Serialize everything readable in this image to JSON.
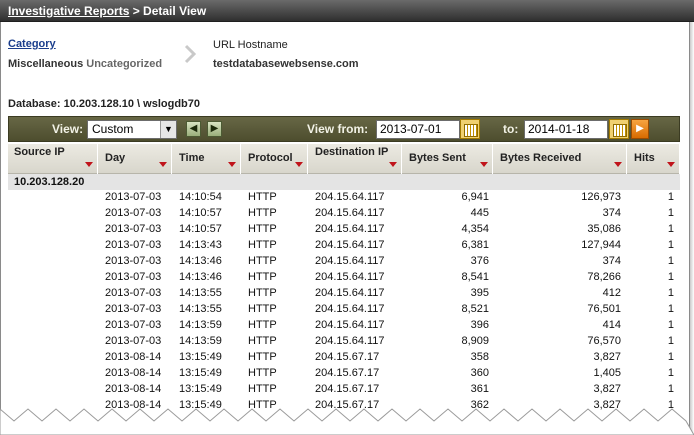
{
  "header": {
    "breadcrumb_link": "Investigative Reports",
    "breadcrumb_tail": " > Detail View"
  },
  "criteria": {
    "category_label": "Category",
    "category_value_main": "Miscellaneous",
    "category_value_sub": "Uncategorized",
    "url_header": "URL Hostname",
    "url_value": "testdatabasewebsense.com"
  },
  "database": {
    "label": "Database:",
    "value": "10.203.128.10 \\ wslogdb70"
  },
  "toolbar": {
    "view_label": "View:",
    "view_selected": "Custom",
    "view_from_label": "View from:",
    "from_date": "2013-07-01",
    "to_label": "to:",
    "to_date": "2014-01-18"
  },
  "table": {
    "columns": [
      "Source IP",
      "Day",
      "Time",
      "Protocol",
      "Destination IP",
      "Bytes Sent",
      "Bytes Received",
      "Hits"
    ],
    "group_ip": "10.203.128.20",
    "rows": [
      [
        "2013-07-03",
        "14:10:54",
        "HTTP",
        "204.15.64.117",
        "6,941",
        "126,973",
        "1"
      ],
      [
        "2013-07-03",
        "14:10:57",
        "HTTP",
        "204.15.64.117",
        "445",
        "374",
        "1"
      ],
      [
        "2013-07-03",
        "14:10:57",
        "HTTP",
        "204.15.64.117",
        "4,354",
        "35,086",
        "1"
      ],
      [
        "2013-07-03",
        "14:13:43",
        "HTTP",
        "204.15.64.117",
        "6,381",
        "127,944",
        "1"
      ],
      [
        "2013-07-03",
        "14:13:46",
        "HTTP",
        "204.15.64.117",
        "376",
        "374",
        "1"
      ],
      [
        "2013-07-03",
        "14:13:46",
        "HTTP",
        "204.15.64.117",
        "8,541",
        "78,266",
        "1"
      ],
      [
        "2013-07-03",
        "14:13:55",
        "HTTP",
        "204.15.64.117",
        "395",
        "412",
        "1"
      ],
      [
        "2013-07-03",
        "14:13:55",
        "HTTP",
        "204.15.64.117",
        "8,521",
        "76,501",
        "1"
      ],
      [
        "2013-07-03",
        "14:13:59",
        "HTTP",
        "204.15.64.117",
        "396",
        "414",
        "1"
      ],
      [
        "2013-07-03",
        "14:13:59",
        "HTTP",
        "204.15.64.117",
        "8,909",
        "76,570",
        "1"
      ],
      [
        "2013-08-14",
        "13:15:49",
        "HTTP",
        "204.15.67.17",
        "358",
        "3,827",
        "1"
      ],
      [
        "2013-08-14",
        "13:15:49",
        "HTTP",
        "204.15.67.17",
        "360",
        "1,405",
        "1"
      ],
      [
        "2013-08-14",
        "13:15:49",
        "HTTP",
        "204.15.67.17",
        "361",
        "3,827",
        "1"
      ],
      [
        "2013-08-14",
        "13:15:49",
        "HTTP",
        "204.15.67.17",
        "362",
        "3,827",
        "1"
      ]
    ]
  }
}
